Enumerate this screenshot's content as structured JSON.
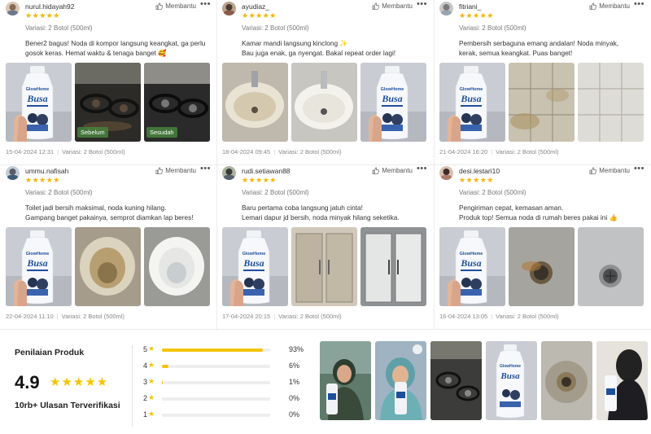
{
  "reviews": [
    {
      "username": "nurul.hidayah92",
      "stars": "★★★★★",
      "helpful_label": "Membantu",
      "variant": "Variasi: 2 Botol (500ml)",
      "text": "Bener2 bagus! Noda di kompor langsung keangkat, ga perlu\ngosok keras. Hemat waktu & tenaga banget 🥰",
      "photo_tags": [
        "",
        "Sebelum",
        "Sesudah"
      ],
      "date": "15-04-2024 12:31",
      "variant_footer": "Variasi: 2 Botol (500ml)"
    },
    {
      "username": "ayudiaz_",
      "stars": "★★★★★",
      "helpful_label": "Membantu",
      "variant": "Variasi: 2 Botol (500ml)",
      "text": "Kamar mandi langsung kinclong ✨\nBau juga enak, ga nyengat.  Bakal repeat order lagi!",
      "photo_tags": [
        "",
        "",
        ""
      ],
      "date": "18-04-2024 09:45",
      "variant_footer": "Variasi: 2 Botol (500ml)"
    },
    {
      "username": "fitriani_",
      "stars": "★★★★★",
      "helpful_label": "Membantu",
      "variant": "Variasi: 2 Botol (500ml)",
      "text": "Pembersih serbaguna emang andalan! Noda minyak,\nkerak, semua keangkat. Puas banget!",
      "photo_tags": [
        "",
        "",
        ""
      ],
      "date": "21-04-2024 16:20",
      "variant_footer": "Variasi: 2 Botol (500ml)"
    },
    {
      "username": "ummu.nafisah",
      "stars": "★★★★★",
      "helpful_label": "Membantu",
      "variant": "Variasi: 2 Botol (500ml)",
      "text": "Toilet jadi bersih maksimal, noda kuning hilang.\nGampang banget pakainya, semprot diamkan lap beres!",
      "photo_tags": [
        "",
        "",
        ""
      ],
      "date": "22-04-2024 11:10",
      "variant_footer": "Variasi: 2 Botol (500ml)"
    },
    {
      "username": "rudi.setiawan88",
      "stars": "★★★★★",
      "helpful_label": "Membantu",
      "variant": "Variasi: 2 Botol (500ml)",
      "text": "Baru pertama coba langsung jatuh cinta!\nLemari dapur jd bersih, noda minyak hilang seketika.",
      "photo_tags": [
        "",
        "",
        ""
      ],
      "date": "17-04-2024 20:15",
      "variant_footer": "Variasi: 2 Botol (500ml)"
    },
    {
      "username": "desi.lestari10",
      "stars": "★★★★★",
      "helpful_label": "Membantu",
      "variant": "Variasi: 2 Botol (500ml)",
      "text": "Pengiriman cepat, kemasan aman.\nProduk top! Semua noda di rumah beres pakai ini 👍",
      "photo_tags": [
        "",
        "",
        ""
      ],
      "date": "16-04-2024 13:05",
      "variant_footer": "Variasi: 2 Botol (500ml)"
    }
  ],
  "product_brand": "GlowHome",
  "product_name": "Busa",
  "summary": {
    "title": "Penilaian Produk",
    "score": "4.9",
    "stars": "★★★★★",
    "count_label": "10rb+ Ulasan Terverifikasi",
    "breakdown": [
      {
        "label": "5",
        "fraction": 0.93,
        "percent": "93%"
      },
      {
        "label": "4",
        "fraction": 0.06,
        "percent": "6%"
      },
      {
        "label": "3",
        "fraction": 0.01,
        "percent": "1%"
      },
      {
        "label": "2",
        "fraction": 0.0,
        "percent": "0%"
      },
      {
        "label": "1",
        "fraction": 0.0,
        "percent": "0%"
      }
    ]
  },
  "colors": {
    "star": "#f5b400",
    "bar": "#f5c400",
    "tag_bg": "#46823c",
    "bottle": "#f7f8fb",
    "label_blue": "#1d4f9c"
  }
}
